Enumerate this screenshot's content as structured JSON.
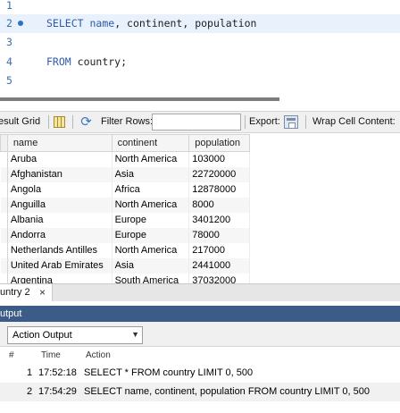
{
  "editor": {
    "lines": [
      {
        "num": "1",
        "text": ""
      },
      {
        "num": "2",
        "kw1": "SELECT",
        "rest1": "name",
        "rest2": ", continent, population"
      },
      {
        "num": "3",
        "text": ""
      },
      {
        "num": "4",
        "kw1": "FROM",
        "rest1": "country;"
      },
      {
        "num": "5",
        "text": ""
      }
    ]
  },
  "toolbar": {
    "result_grid_label": "esult Grid",
    "filter_rows_label": "Filter Rows:",
    "filter_value": "",
    "export_label": "Export:",
    "wrap_label": "Wrap Cell Content:"
  },
  "grid": {
    "columns": [
      "name",
      "continent",
      "population"
    ],
    "rows": [
      [
        "Aruba",
        "North America",
        "103000"
      ],
      [
        "Afghanistan",
        "Asia",
        "22720000"
      ],
      [
        "Angola",
        "Africa",
        "12878000"
      ],
      [
        "Anguilla",
        "North America",
        "8000"
      ],
      [
        "Albania",
        "Europe",
        "3401200"
      ],
      [
        "Andorra",
        "Europe",
        "78000"
      ],
      [
        "Netherlands Antilles",
        "North America",
        "217000"
      ],
      [
        "United Arab Emirates",
        "Asia",
        "2441000"
      ],
      [
        "Argentina",
        "South America",
        "37032000"
      ]
    ]
  },
  "query_tab": {
    "label": "untry 2",
    "close": "×"
  },
  "output": {
    "title": "utput",
    "selector_value": "Action Output",
    "headers": {
      "num": "#",
      "time": "Time",
      "action": "Action"
    },
    "rows": [
      {
        "num": "1",
        "time": "17:52:18",
        "action": "SELECT *  FROM country LIMIT 0, 500"
      },
      {
        "num": "2",
        "time": "17:54:29",
        "action": "SELECT name, continent, population  FROM country LIMIT 0, 500"
      }
    ]
  },
  "colors": {
    "keyword": "#2d5ba8",
    "panel_header": "#3c5b87",
    "current_line": "#e9f1fd"
  },
  "icons": [
    "grid-view-icon",
    "refresh-icon",
    "export-icon",
    "dropdown-arrow-icon",
    "close-icon"
  ]
}
